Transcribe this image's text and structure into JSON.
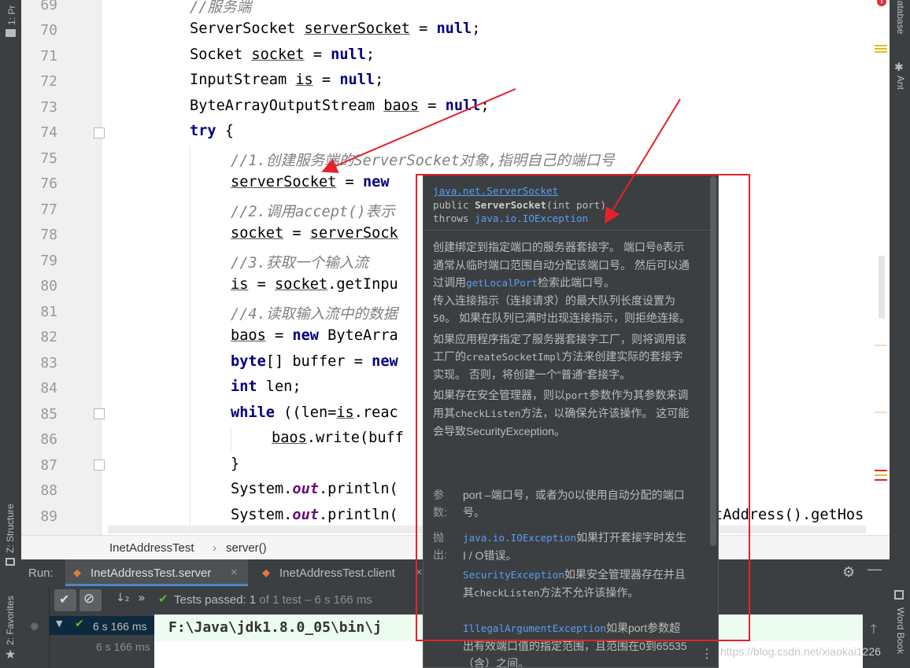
{
  "left_strip": {
    "project_label": "1: Pr",
    "structure_label": "Z: Structure",
    "favorites_label": "2: Favorites"
  },
  "right_strip": {
    "database_label": "Database",
    "ant_label": "Ant",
    "wordbook_label": "Word Book"
  },
  "editor": {
    "lines": [
      {
        "num": "69"
      },
      {
        "num": "70"
      },
      {
        "num": "71"
      },
      {
        "num": "72"
      },
      {
        "num": "73"
      },
      {
        "num": "74"
      },
      {
        "num": "75"
      },
      {
        "num": "76"
      },
      {
        "num": "77"
      },
      {
        "num": "78"
      },
      {
        "num": "79"
      },
      {
        "num": "80"
      },
      {
        "num": "81"
      },
      {
        "num": "82"
      },
      {
        "num": "83"
      },
      {
        "num": "84"
      },
      {
        "num": "85"
      },
      {
        "num": "86"
      },
      {
        "num": "87"
      },
      {
        "num": "88"
      },
      {
        "num": "89"
      }
    ],
    "code": {
      "l69": "//服务端",
      "l70_type": "ServerSocket ",
      "l70_var": "serverSocket",
      "l70_eq": " = ",
      "l70_null": "null",
      "l70_end": ";",
      "l71_type": "Socket ",
      "l71_var": "socket",
      "l71_eq": " = ",
      "l71_null": "null",
      "l71_end": ";",
      "l72_type": "InputStream ",
      "l72_var": "is",
      "l72_eq": " = ",
      "l72_null": "null",
      "l72_end": ";",
      "l73_type": "ByteArrayOutputStream ",
      "l73_var": "baos",
      "l73_eq": " = ",
      "l73_null": "null",
      "l73_end": ";",
      "l74_kw": "try",
      "l74_rest": " {",
      "l75": "//1.创建服务端的ServerSocket对象,指明自己的端口号",
      "l76_var": "serverSocket",
      "l76_eq": " = ",
      "l76_kw": "new",
      "l77": "//2.调用accept()表示",
      "l78_var": "socket",
      "l78_eq": " = ",
      "l78_rest": "serverSock",
      "l79": "//3.获取一个输入流",
      "l80_var": "is",
      "l80_eq": " = ",
      "l80_obj": "socket",
      "l80_rest": ".getInpu",
      "l81": "//4.读取输入流中的数据",
      "l82_var": "baos",
      "l82_eq": " = ",
      "l82_kw": "new",
      "l82_rest": " ByteArra",
      "l83_kw": "byte",
      "l83_rest": "[] buffer = ",
      "l83_kw2": "new",
      "l84_kw": "int",
      "l84_rest": " len;",
      "l85_kw": "while",
      "l85_rest1": " ((len=",
      "l85_var": "is",
      "l85_rest2": ".reac",
      "l86_var": "baos",
      "l86_rest": ".write(buff",
      "l87": "}",
      "l88_a": "System.",
      "l88_fld": "out",
      "l88_b": ".println(",
      "l89_a": "System.",
      "l89_fld": "out",
      "l89_b": ".println(",
      "l89_tail": "tAddress().getHos"
    }
  },
  "breadcrumb": {
    "class_name": "InetAddressTest",
    "separator": "›",
    "method_name": "server()"
  },
  "run_panel": {
    "run_label": "Run:",
    "tabs": [
      {
        "label": "InetAddressTest.server",
        "close": "×"
      },
      {
        "label": "InetAddressTest.client",
        "close": "×"
      }
    ],
    "status_prefix": "Tests passed: ",
    "passed_count": "1",
    "status_suffix": " of 1 test – 6 s 166 ms",
    "tree_root_time": "6 s 166 ms",
    "tree_child_time": "6 s 166 ms",
    "console_line": "F:\\Java\\jdk1.8.0_05\\bin\\j"
  },
  "doc_popup": {
    "class_link": "java.net.ServerSocket",
    "signature_prefix": "public ",
    "signature_name": "ServerSocket",
    "signature_params": "(int port)",
    "throws_label": "throws ",
    "throws_link": "java.io.IOException",
    "desc_p1_a": "创建绑定到指定端口的服务器套接字。 端口号",
    "desc_p1_zero": "0",
    "desc_p1_b": "表示通常从临时端口范围自动分配该端口号。 然后可以通过调用",
    "desc_p1_link": "getLocalPort",
    "desc_p1_c": "检索此端口号。",
    "desc_p2_a": "传入连接指示（连接请求）的最大队列长度设置为",
    "desc_p2_num": "50",
    "desc_p2_b": "。 如果在队列已满时出现连接指示，则拒绝连接。",
    "desc_p3_a": "如果应用程序指定了服务器套接字工厂，则将调用该工厂的",
    "desc_p3_code": "createSocketImpl",
    "desc_p3_b": "方法来创建实际的套接字实现。 否则，将创建一个“普通”套接字。",
    "desc_p4_a": "如果存在安全管理器，则以",
    "desc_p4_code1": "port",
    "desc_p4_b": "参数作为其参数来调用其",
    "desc_p4_code2": "checkListen",
    "desc_p4_c": "方法，以确保允许该操作。 这可能会导致SecurityException。",
    "params_label": "参数:",
    "params_text": "port –端口号，或者为0以使用自动分配的端口号。",
    "throws_section_label": "抛出:",
    "throws1_link": "java.io.IOException",
    "throws1_text": "如果打开套接字时发生I / O错误。",
    "throws2_link": "SecurityException",
    "throws2_text_a": "如果安全管理器存在并且其",
    "throws2_code": "checkListen",
    "throws2_text_b": "方法不允许该操作。",
    "throws3_link": "IllegalArgumentException",
    "throws3_text": "如果port参数超出有效端口值的指定范围，且范围在0到65535（含）之间。"
  },
  "watermark": "https://blog.csdn.net/xiaokai1226",
  "colors": {
    "annotation_red": "#e5222a",
    "keyword": "#000080",
    "comment": "#808080",
    "link": "#589df6",
    "test_pass": "#5fb832"
  }
}
